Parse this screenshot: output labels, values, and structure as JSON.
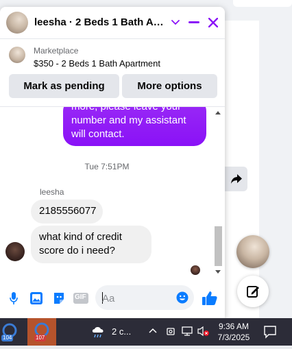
{
  "chat": {
    "title": "leesha · 2 Beds 1 Bath Apa...",
    "listing": {
      "kicker": "Marketplace",
      "name": "$350 - 2 Beds 1 Bath Apartment",
      "mark_pending": "Mark as pending",
      "more_options": "More options"
    },
    "messages": {
      "outgoing_text": "more, please leave your\nnumber and my assistant\nwill contact.",
      "time_separator": "Tue 7:51PM",
      "sender": "leesha",
      "incoming": [
        {
          "text": "2185556077"
        },
        {
          "text": "what kind of credit\nscore do i need?"
        }
      ]
    },
    "composer": {
      "placeholder": "Aa",
      "gif_label": "GIF"
    }
  },
  "colors": {
    "accent": "#8a11f7",
    "messenger_blue": "#0a7cff",
    "taskbar": "#2c2c38"
  },
  "taskbar": {
    "badge_left": "104",
    "badge_right": "107",
    "weather_text": "2 c...",
    "time": "9:36 AM",
    "date": "7/3/2025"
  }
}
